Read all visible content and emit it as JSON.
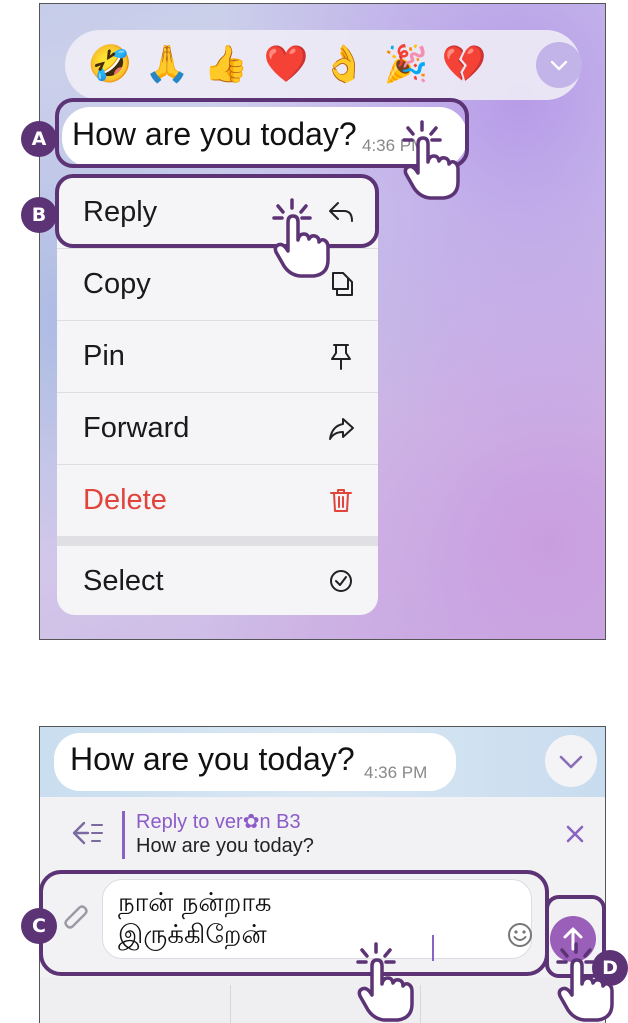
{
  "reactions": {
    "emojis": [
      "🤣",
      "🙏",
      "👍",
      "❤️",
      "👌",
      "🎉",
      "💔"
    ],
    "more_icon": "chevron-down-icon"
  },
  "message": {
    "text": "How are you today?",
    "time": "4:36 PM"
  },
  "context_menu": {
    "items": [
      {
        "label": "Reply",
        "icon": "reply-icon",
        "color": "#1a1a1a"
      },
      {
        "label": "Copy",
        "icon": "copy-icon",
        "color": "#1a1a1a"
      },
      {
        "label": "Pin",
        "icon": "pin-icon",
        "color": "#1a1a1a"
      },
      {
        "label": "Forward",
        "icon": "forward-icon",
        "color": "#1a1a1a"
      },
      {
        "label": "Delete",
        "icon": "trash-icon",
        "color": "#e0443a"
      },
      {
        "label": "Select",
        "icon": "check-circle-icon",
        "color": "#1a1a1a"
      }
    ]
  },
  "annotations": {
    "A": "A",
    "B": "B",
    "C": "C",
    "D": "D"
  },
  "composer": {
    "reply_title": "Reply to ver✿n B3",
    "reply_quote": "How are you today?",
    "input_text": "நான் நன்றாக\nஇருக்கிறேன்"
  },
  "colors": {
    "annotation": "#5c3375",
    "accent": "#8c5bc8",
    "send_button": "#9a5fb8",
    "delete": "#e0443a"
  }
}
